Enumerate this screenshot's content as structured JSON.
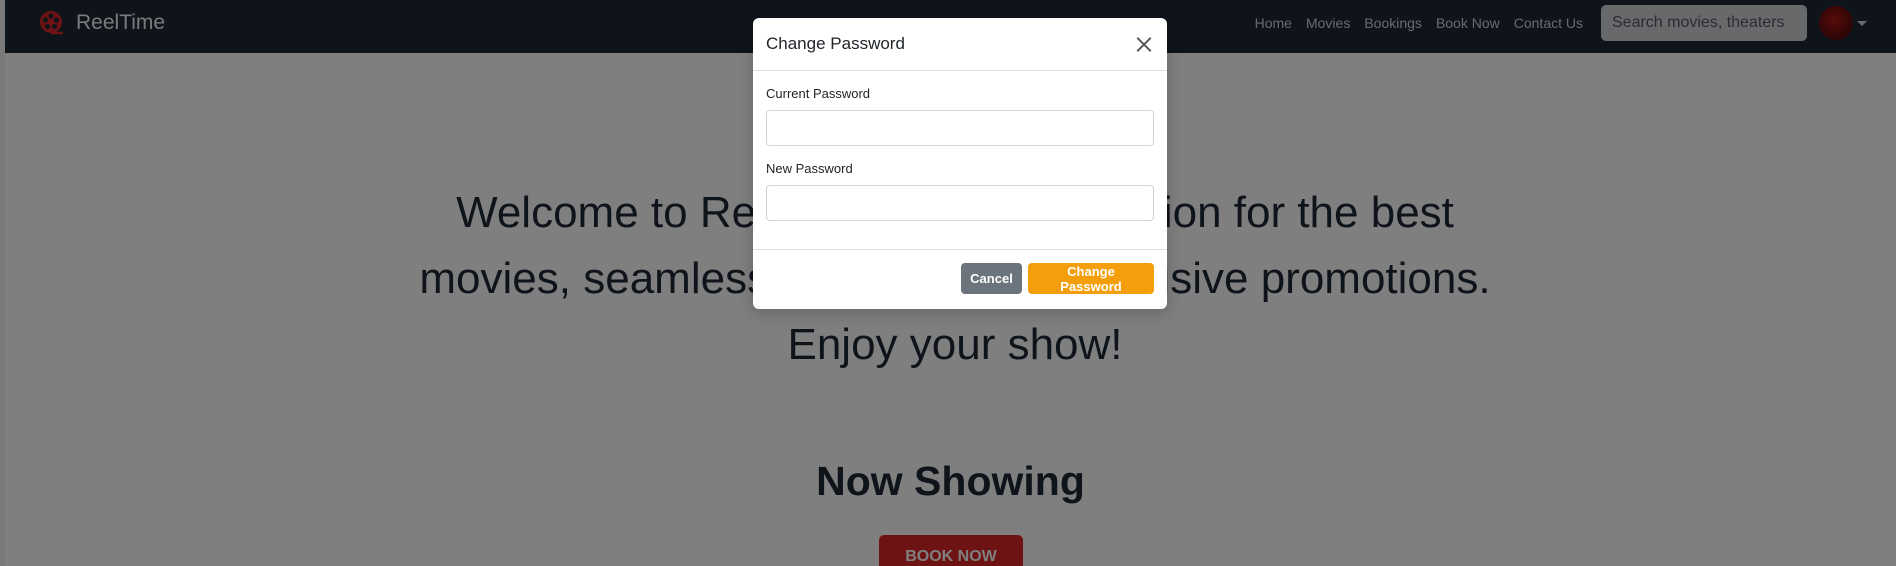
{
  "navbar": {
    "brand": "ReelTime",
    "links": [
      "Home",
      "Movies",
      "Bookings",
      "Book Now",
      "Contact Us"
    ],
    "search_placeholder": "Search movies, theaters"
  },
  "hero": {
    "text": "Welcome to ReelTime, your destination for the best movies, seamless bookings, and exclusive promotions. Enjoy your show!",
    "section_title": "Now Showing",
    "book_button": "BOOK NOW"
  },
  "modal": {
    "title": "Change Password",
    "fields": [
      {
        "label": "Current Password",
        "value": ""
      },
      {
        "label": "New Password",
        "value": ""
      }
    ],
    "cancel_label": "Cancel",
    "submit_label": "Change Password"
  },
  "colors": {
    "navbar": "#1f2937",
    "accent_orange": "#f59e0b",
    "book_red": "#dc2626"
  }
}
